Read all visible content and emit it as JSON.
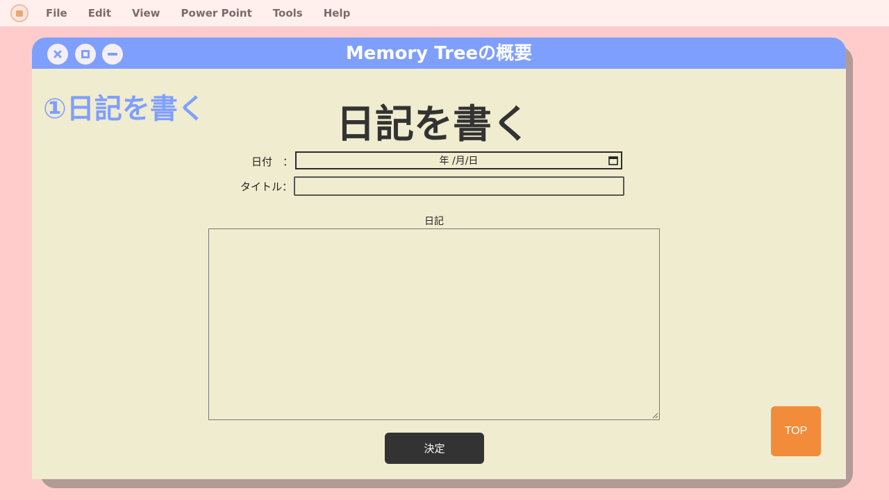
{
  "menubar": {
    "logo_icon": "hamster-app-icon",
    "items": [
      "File",
      "Edit",
      "View",
      "Power Point",
      "Tools",
      "Help"
    ]
  },
  "window": {
    "title": "Memory Treeの概要",
    "controls": [
      "close-icon",
      "maximize-icon",
      "minimize-icon"
    ]
  },
  "section_label": "①日記を書く",
  "page_title": "日記を書く",
  "form": {
    "date_label": "日付　：",
    "date_value": "年 /月/日",
    "title_label": "タイトル：",
    "title_value": "",
    "diary_label": "日記",
    "diary_value": "",
    "submit_label": "決定"
  },
  "top_button_label": "TOP",
  "colors": {
    "background": "#ffcccb",
    "menubar": "#fff0ee",
    "titlebar": "#7f9fff",
    "window_body": "#f0eccf",
    "window_shadow": "#b39a96",
    "section_label": "#7f9fff",
    "submit_button": "#333333",
    "top_button": "#f28c3b"
  }
}
